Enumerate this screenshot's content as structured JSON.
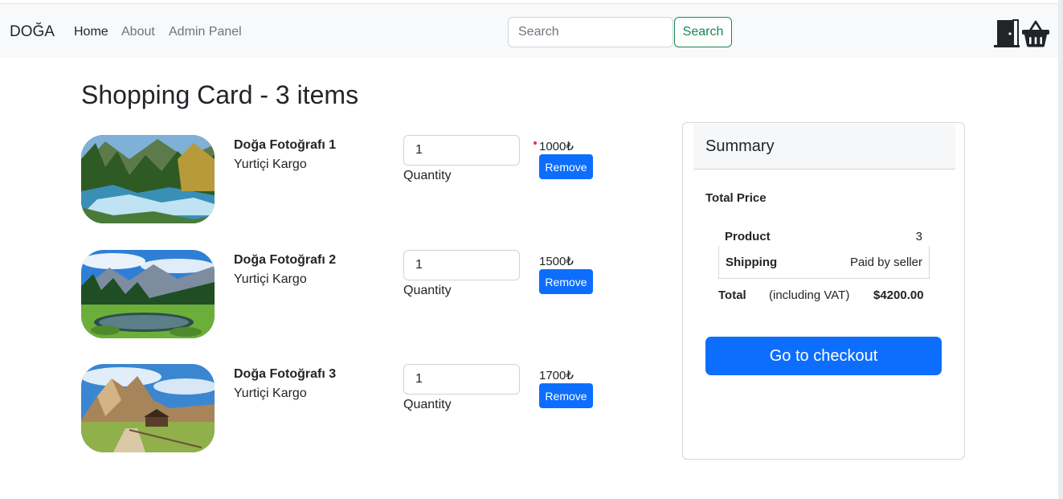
{
  "navbar": {
    "brand": "DOĞA",
    "links": [
      "Home",
      "About",
      "Admin Panel"
    ],
    "search_placeholder": "Search",
    "search_button": "Search",
    "icons": [
      "door-icon",
      "basket-icon"
    ]
  },
  "page": {
    "title": "Shopping Card - 3 items"
  },
  "cart": {
    "items": [
      {
        "name": "Doğa Fotoğrafı 1",
        "shipping": "Yurtiçi Kargo",
        "quantity": "1",
        "quantity_label": "Quantity",
        "price": "1000₺",
        "remove_label": "Remove"
      },
      {
        "name": "Doğa Fotoğrafı 2",
        "shipping": "Yurtiçi Kargo",
        "quantity": "1",
        "quantity_label": "Quantity",
        "price": "1500₺",
        "remove_label": "Remove"
      },
      {
        "name": "Doğa Fotoğrafı 3",
        "shipping": "Yurtiçi Kargo",
        "quantity": "1",
        "quantity_label": "Quantity",
        "price": "1700₺",
        "remove_label": "Remove"
      }
    ]
  },
  "summary": {
    "title": "Summary",
    "total_price_label": "Total Price",
    "product_label": "Product",
    "product_value": "3",
    "shipping_label": "Shipping",
    "shipping_value": "Paid by seller",
    "total_label": "Total",
    "total_note": "(including VAT)",
    "total_value": "$4200.00",
    "checkout_label": "Go to checkout"
  },
  "colors": {
    "primary": "#0d6efd",
    "success": "#198754",
    "navbar_bg": "#f8f9fa",
    "text": "#212529",
    "muted": "#6c757d"
  }
}
